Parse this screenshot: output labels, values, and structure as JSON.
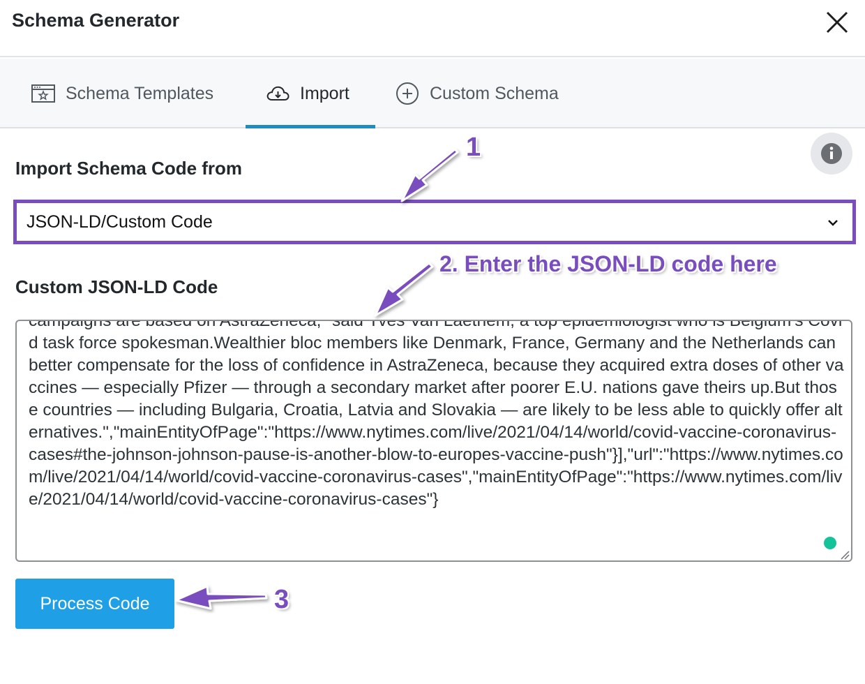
{
  "header": {
    "title": "Schema Generator"
  },
  "tabs": [
    {
      "label": "Schema Templates",
      "icon": "schema-templates-icon"
    },
    {
      "label": "Import",
      "icon": "cloud-download-icon",
      "active": true
    },
    {
      "label": "Custom Schema",
      "icon": "plus-circle-icon"
    }
  ],
  "import": {
    "source_label": "Import Schema Code from",
    "source_value": "JSON-LD/Custom Code",
    "code_label": "Custom JSON-LD Code",
    "code_value": "campaigns are based on AstraZeneca,\" said Yves Van Laethem, a top epidemiologist who is Belgium’s Covid task force spokesman.Wealthier bloc members like Denmark, France, Germany and the Netherlands can better compensate for the loss of confidence in AstraZeneca, because they acquired extra doses of other vaccines — especially Pfizer — through a secondary market after poorer E.U. nations gave theirs up.But those countries — including Bulgaria, Croatia, Latvia and Slovakia — are likely to be less able to quickly offer alternatives.\",\"mainEntityOfPage\":\"https://www.nytimes.com/live/2021/04/14/world/covid-vaccine-coronavirus-cases#the-johnson-johnson-pause-is-another-blow-to-europes-vaccine-push\"}],\"url\":\"https://www.nytimes.com/live/2021/04/14/world/covid-vaccine-coronavirus-cases\",\"mainEntityOfPage\":\"https://www.nytimes.com/live/2021/04/14/world/covid-vaccine-coronavirus-cases\"}",
    "process_button": "Process Code"
  },
  "annotations": {
    "step1": "1",
    "step2": "2. Enter the JSON-LD code here",
    "step3": "3",
    "color": "#7a4dbf"
  },
  "colors": {
    "accent": "#1e8cbe",
    "button": "#1e9fe6",
    "annotation": "#7a4dbf"
  }
}
